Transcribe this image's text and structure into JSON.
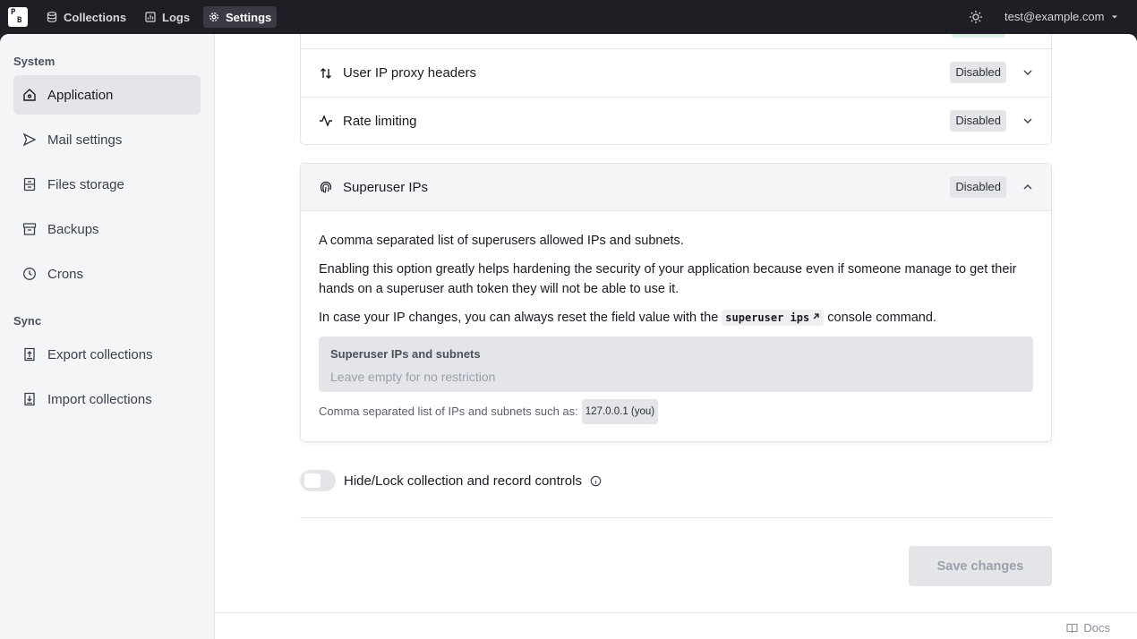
{
  "topbar": {
    "logo_top": "P",
    "logo_bottom": "B",
    "nav": [
      {
        "label": "Collections",
        "icon": "database-icon"
      },
      {
        "label": "Logs",
        "icon": "chart-icon"
      },
      {
        "label": "Settings",
        "icon": "gear-icon",
        "active": true
      }
    ],
    "user_email": "test@example.com"
  },
  "sidebar": {
    "groups": [
      {
        "title": "System",
        "items": [
          {
            "label": "Application",
            "icon": "home-icon",
            "active": true
          },
          {
            "label": "Mail settings",
            "icon": "send-icon"
          },
          {
            "label": "Files storage",
            "icon": "storage-icon"
          },
          {
            "label": "Backups",
            "icon": "archive-icon"
          },
          {
            "label": "Crons",
            "icon": "clock-icon"
          }
        ]
      },
      {
        "title": "Sync",
        "items": [
          {
            "label": "Export collections",
            "icon": "export-icon"
          },
          {
            "label": "Import collections",
            "icon": "import-icon"
          }
        ]
      }
    ]
  },
  "main": {
    "accordion": [
      {
        "label": "User IP proxy headers",
        "status": "Disabled",
        "icon": "switch-icon"
      },
      {
        "label": "Rate limiting",
        "status": "Disabled",
        "icon": "pulse-icon"
      }
    ],
    "superuser_panel": {
      "title": "Superuser IPs",
      "status": "Disabled",
      "icon": "fingerprint-icon",
      "desc1": "A comma separated list of superusers allowed IPs and subnets.",
      "desc2": "Enabling this option greatly helps hardening the security of your application because even if someone manage to get their hands on a superuser auth token they will not be able to use it.",
      "desc3_pre": "In case your IP changes, you can always reset the field value with the",
      "desc3_code": "superuser ips",
      "desc3_post": "console command.",
      "field_label": "Superuser IPs and subnets",
      "field_value": "",
      "field_placeholder": "Leave empty for no restriction",
      "help_text": "Comma separated list of IPs and subnets such as:",
      "help_chip": "127.0.0.1 (you)"
    },
    "hide_controls": {
      "label": "Hide/Lock collection and record controls",
      "enabled": false
    },
    "save_label": "Save changes"
  },
  "footer": {
    "docs_label": "Docs"
  },
  "colors": {
    "accent_dark": "#1e1e24",
    "disabled_bg": "#e4e5e9",
    "success_bg": "#d8f3e4"
  }
}
